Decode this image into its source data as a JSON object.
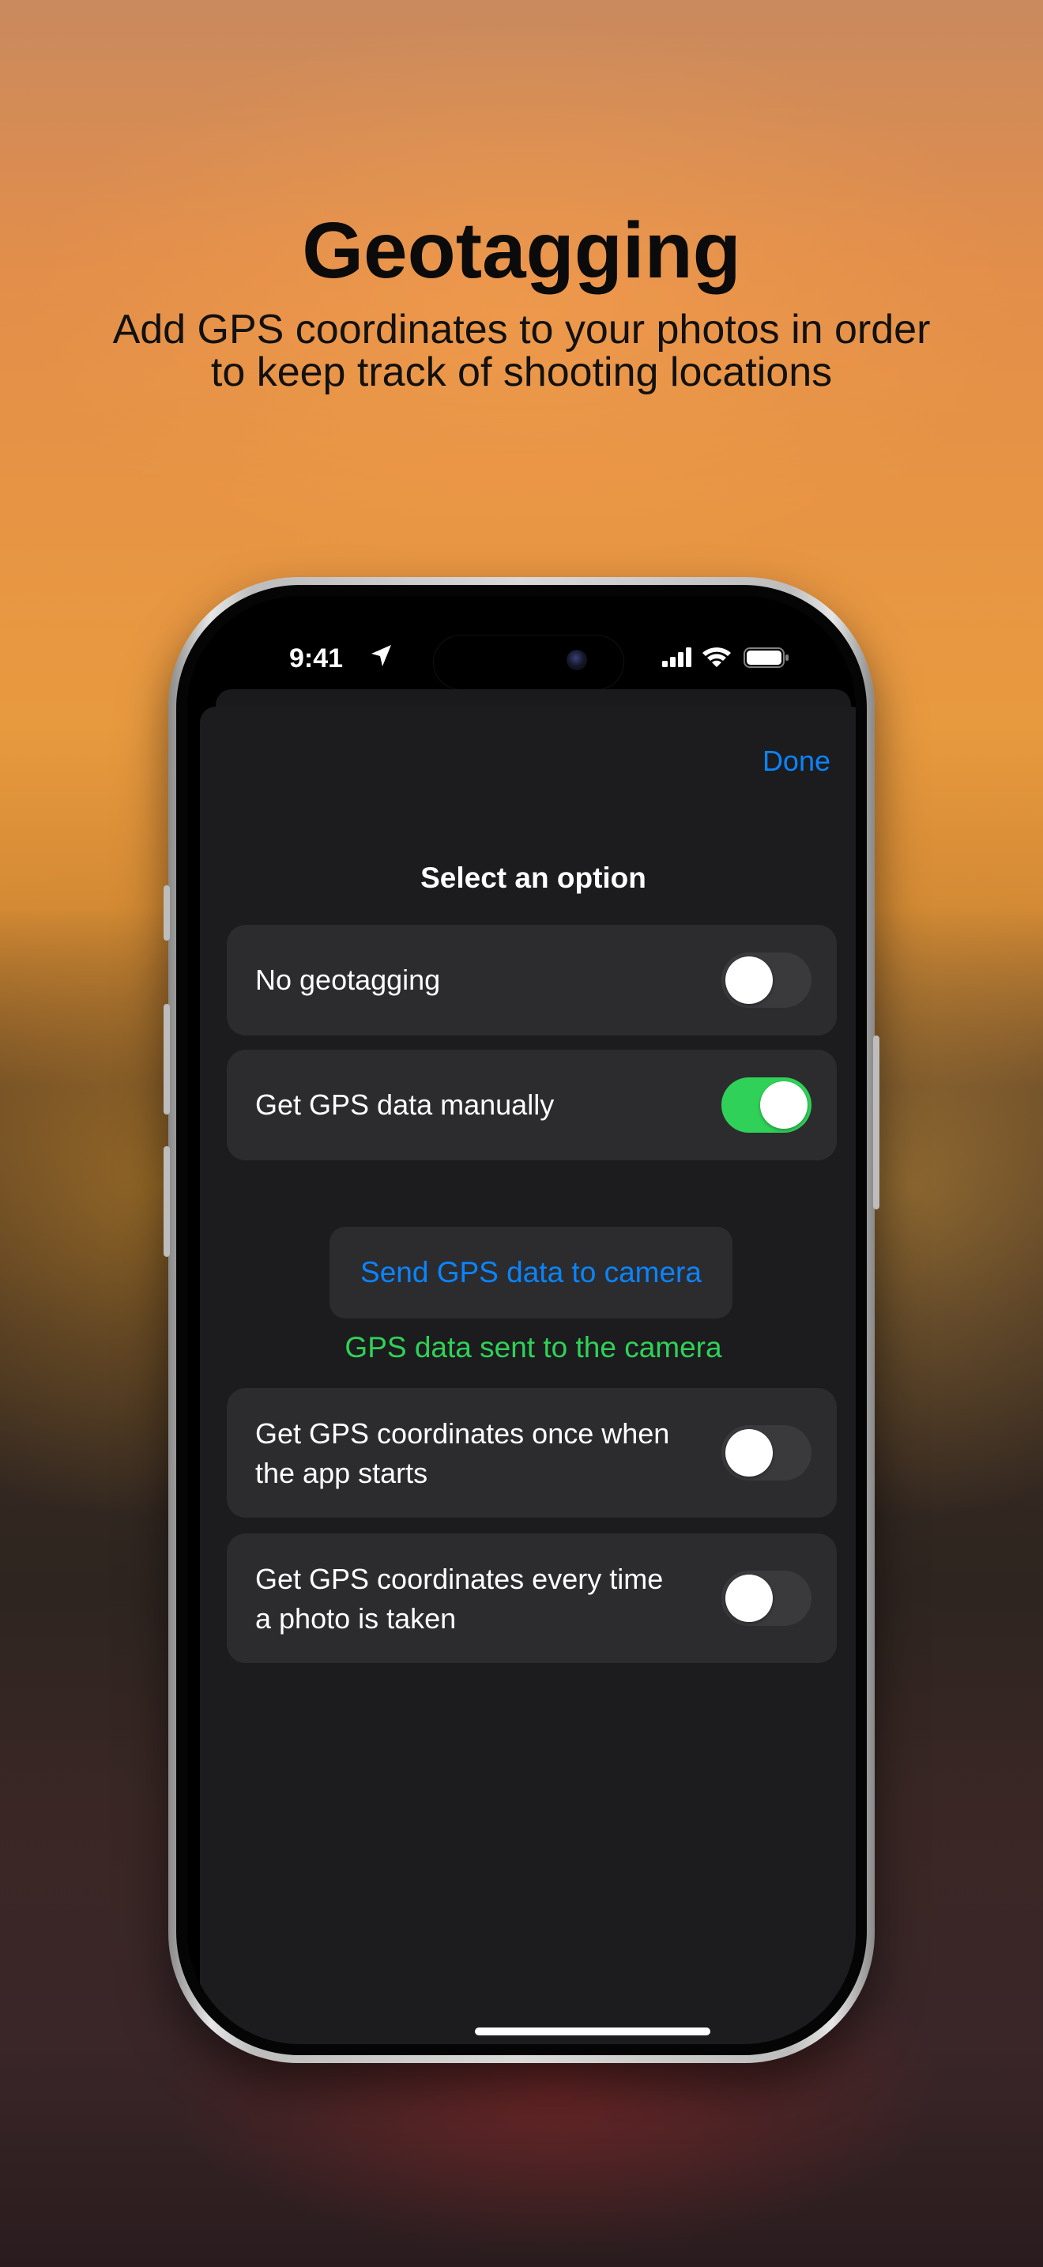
{
  "header": {
    "title": "Geotagging",
    "subtitle_line1": "Add GPS coordinates to your photos in order",
    "subtitle_line2": "to keep track of shooting locations"
  },
  "status_bar": {
    "time": "9:41",
    "icons": [
      "location-arrow-icon",
      "cellular-signal-icon",
      "wifi-icon",
      "battery-icon"
    ]
  },
  "sheet": {
    "done_label": "Done",
    "title": "Select an option",
    "options": [
      {
        "line1": "No geotagging",
        "line2": "",
        "enabled": false
      },
      {
        "line1": "Get GPS data manually",
        "line2": "",
        "enabled": true
      },
      {
        "line1": "Get GPS coordinates once when",
        "line2": "the app starts",
        "enabled": false
      },
      {
        "line1": "Get GPS coordinates every time",
        "line2": "a photo is taken",
        "enabled": false
      }
    ],
    "send_button_label": "Send GPS data to camera",
    "status_message": "GPS data sent to the camera"
  },
  "colors": {
    "accent_blue": "#0a84ff",
    "success_green": "#30d158",
    "sheet_bg": "#1c1c1e",
    "row_bg": "#2c2c2e"
  }
}
